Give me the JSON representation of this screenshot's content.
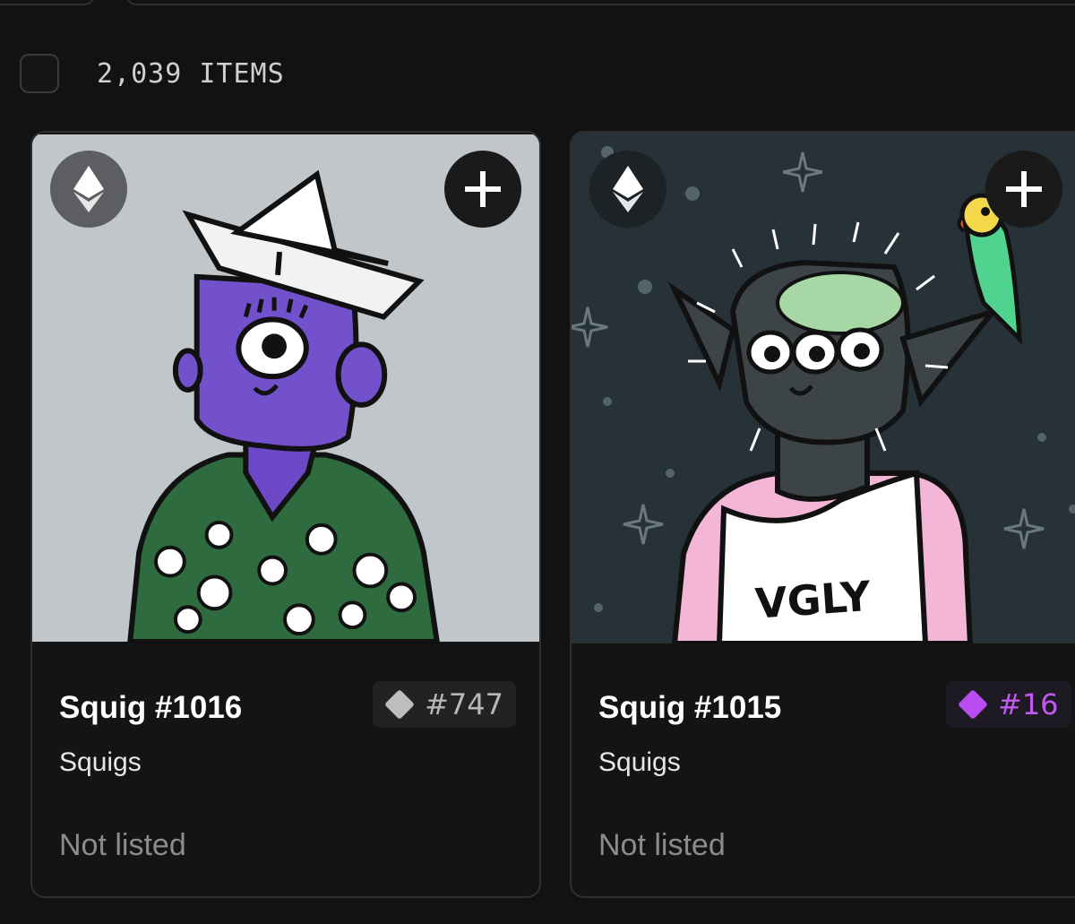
{
  "toolbar": {
    "item_count": "2,039 ITEMS"
  },
  "cards": [
    {
      "name": "Squig #1016",
      "collection": "Squigs",
      "status": "Not listed",
      "rank": "#747",
      "rank_color": "#bdbdbd",
      "chain_icon": "ethereum-icon",
      "add_icon": "plus-icon",
      "art_bg": "#c1c6cb"
    },
    {
      "name": "Squig #1015",
      "collection": "Squigs",
      "status": "Not listed",
      "rank": "#16",
      "rank_color": "#b94cf0",
      "chain_icon": "ethereum-icon",
      "add_icon": "plus-icon",
      "art_bg": "#263238",
      "shirt_text": "VGLY"
    }
  ]
}
